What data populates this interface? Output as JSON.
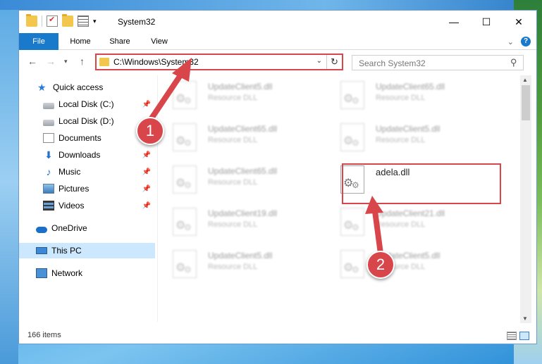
{
  "window": {
    "title": "System32"
  },
  "ribbon": {
    "tabs": [
      {
        "label": "File"
      },
      {
        "label": "Home"
      },
      {
        "label": "Share"
      },
      {
        "label": "View"
      }
    ]
  },
  "address": {
    "path": "C:\\Windows\\System32"
  },
  "search": {
    "placeholder": "Search System32"
  },
  "navigation": {
    "items": [
      {
        "label": "Quick access",
        "icon": "star-icon",
        "pinned": false
      },
      {
        "label": "Local Disk (C:)",
        "icon": "drive-icon",
        "pinned": true
      },
      {
        "label": "Local Disk (D:)",
        "icon": "drive-icon",
        "pinned": false
      },
      {
        "label": "Documents",
        "icon": "documents-icon",
        "pinned": false
      },
      {
        "label": "Downloads",
        "icon": "download-icon",
        "pinned": true
      },
      {
        "label": "Music",
        "icon": "music-icon",
        "pinned": true
      },
      {
        "label": "Pictures",
        "icon": "pictures-icon",
        "pinned": true
      },
      {
        "label": "Videos",
        "icon": "videos-icon",
        "pinned": true
      },
      {
        "label": "OneDrive",
        "icon": "onedrive-icon",
        "pinned": false
      },
      {
        "label": "This PC",
        "icon": "this-pc-icon",
        "pinned": false,
        "selected": true
      },
      {
        "label": "Network",
        "icon": "network-icon",
        "pinned": false
      }
    ]
  },
  "files": [
    {
      "name": "UpdateClient5.dll",
      "type": "Resource DLL",
      "blurred": true
    },
    {
      "name": "UpdateClient65.dll",
      "type": "Resource DLL",
      "blurred": true
    },
    {
      "name": "UpdateClient65.dll",
      "type": "Resource DLL",
      "blurred": true
    },
    {
      "name": "UpdateClient5.dll",
      "type": "Resource DLL",
      "blurred": true
    },
    {
      "name": "UpdateClient65.dll",
      "type": "Resource DLL",
      "blurred": true
    },
    {
      "name": "adela.dll",
      "type": "",
      "blurred": false
    },
    {
      "name": "UpdateClient19.dll",
      "type": "Resource DLL",
      "blurred": true
    },
    {
      "name": "UpdateClient21.dll",
      "type": "Resource DLL",
      "blurred": true
    },
    {
      "name": "UpdateClient5.dll",
      "type": "Resource DLL",
      "blurred": true
    },
    {
      "name": "UpdateClient5.dll",
      "type": "Resource DLL",
      "blurred": true
    }
  ],
  "status": {
    "item_count": "166 items"
  },
  "callouts": [
    {
      "label": "1"
    },
    {
      "label": "2"
    }
  ],
  "colors": {
    "accent": "#1979ca",
    "highlight": "#d8454b",
    "selection": "#cce8ff"
  }
}
